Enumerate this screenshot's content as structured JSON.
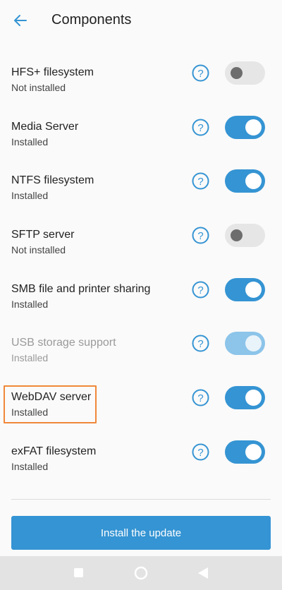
{
  "header": {
    "title": "Components"
  },
  "components": [
    {
      "name": "HFS+ filesystem",
      "status": "Not installed",
      "enabled": false,
      "disabled": false
    },
    {
      "name": "Media Server",
      "status": "Installed",
      "enabled": true,
      "disabled": false
    },
    {
      "name": "NTFS filesystem",
      "status": "Installed",
      "enabled": true,
      "disabled": false
    },
    {
      "name": "SFTP server",
      "status": "Not installed",
      "enabled": false,
      "disabled": false
    },
    {
      "name": "SMB file and printer sharing",
      "status": "Installed",
      "enabled": true,
      "disabled": false
    },
    {
      "name": "USB storage support",
      "status": "Installed",
      "enabled": true,
      "disabled": true
    },
    {
      "name": "WebDAV server",
      "status": "Installed",
      "enabled": true,
      "disabled": false
    },
    {
      "name": "exFAT filesystem",
      "status": "Installed",
      "enabled": true,
      "disabled": false
    }
  ],
  "footer": {
    "install_label": "Install the update"
  },
  "icons": {
    "back": "arrow-left-icon",
    "help": "question-circle-icon",
    "nav_recent": "square-icon",
    "nav_home": "circle-icon",
    "nav_back": "triangle-icon"
  },
  "colors": {
    "accent": "#3594d3",
    "highlight": "#f0883a"
  }
}
